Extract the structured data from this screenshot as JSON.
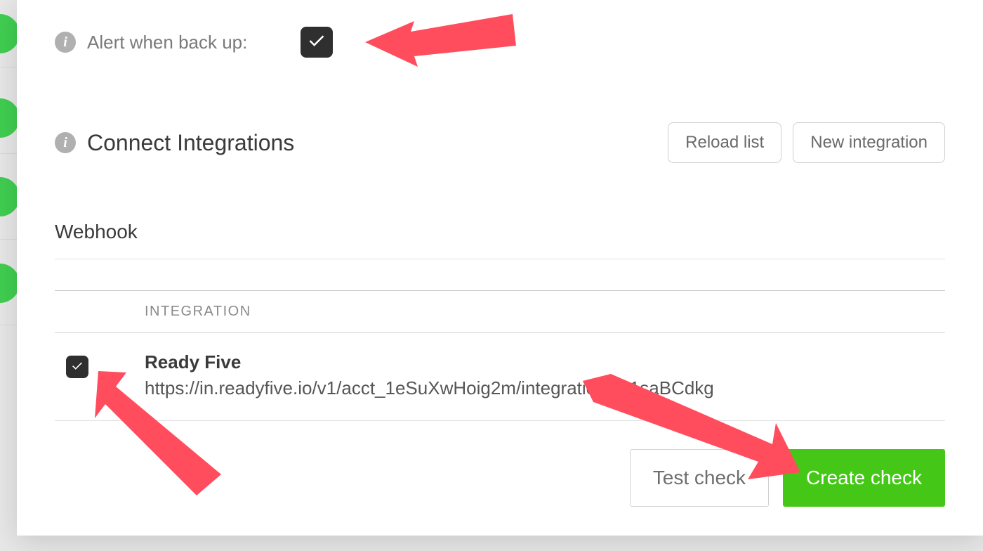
{
  "alert": {
    "label": "Alert when back up:",
    "checked": true
  },
  "integrations": {
    "title": "Connect Integrations",
    "reload_label": "Reload list",
    "new_label": "New integration",
    "category": "Webhook",
    "column_header": "INTEGRATION",
    "items": [
      {
        "checked": true,
        "name": "Ready Five",
        "url": "https://in.readyfive.io/v1/acct_1eSuXwHoig2m/integrations/z1saBCdkg"
      }
    ]
  },
  "footer": {
    "test_label": "Test check",
    "create_label": "Create check"
  }
}
